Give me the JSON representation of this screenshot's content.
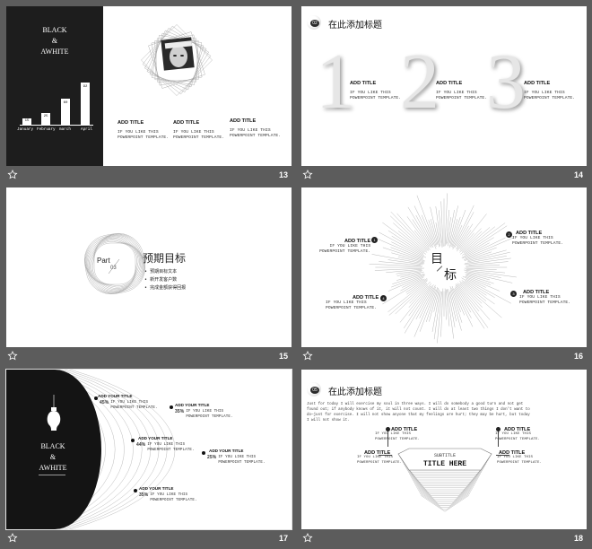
{
  "slides": [
    {
      "number": "13",
      "title": "BLACK",
      "amp": "&",
      "title2": "AWHITE",
      "bars": [
        {
          "label": "January",
          "value": "15",
          "h": 15
        },
        {
          "label": "February",
          "value": "25",
          "h": 25
        },
        {
          "label": "march",
          "value": "60",
          "h": 60
        },
        {
          "label": "April",
          "value": "92",
          "h": 92
        }
      ],
      "cols": [
        {
          "title": "ADD TITLE",
          "l1": "IF YOU LIKE THIS",
          "l2": "POWERPOINT TEMPLATE."
        },
        {
          "title": "ADD TITLE",
          "l1": "IF YOU LIKE THIS",
          "l2": "POWERPOINT TEMPLATE."
        },
        {
          "title": "ADD TITLE",
          "l1": "IF YOU LIKE THIS",
          "l2": "POWERPOINT TEMPLATE."
        }
      ]
    },
    {
      "number": "14",
      "badge": "02",
      "heading": "在此添加标题",
      "digits": [
        "1",
        "2",
        "3"
      ],
      "cols": [
        {
          "title": "ADD TITLE",
          "l1": "IF YOU LIKE THIS",
          "l2": "POWERPOINT TEMPLATE."
        },
        {
          "title": "ADD TITLE",
          "l1": "IF YOU LIKE THIS",
          "l2": "POWERPOINT TEMPLATE."
        },
        {
          "title": "ADD TITLE",
          "l1": "IF YOU LIKE THIS",
          "l2": "POWERPOINT TEMPLATE."
        }
      ]
    },
    {
      "number": "15",
      "part": "Part",
      "partnum": "03",
      "heading": "预期目标",
      "bullets": [
        "预期目标文本",
        "新开发客户数",
        "完成金额获得回报"
      ]
    },
    {
      "number": "16",
      "center1": "目",
      "center2": "标",
      "items": [
        {
          "title": "ADD TITLE",
          "l1": "IF YOU LIKE THIS",
          "l2": "POWERPOINT TEMPLATE."
        },
        {
          "title": "ADD TITLE",
          "l1": "IF YOU LIKE THIS",
          "l2": "POWERPOINT TEMPLATE."
        },
        {
          "title": "ADD TITLE",
          "l1": "IF YOU LIKE THIS",
          "l2": "POWERPOINT TEMPLATE."
        },
        {
          "title": "ADD TITLE",
          "l1": "IF YOU LIKE THIS",
          "l2": "POWERPOINT TEMPLATE."
        }
      ]
    },
    {
      "number": "17",
      "title": "BLACK",
      "amp": "&",
      "title2": "AWHITE",
      "items": [
        {
          "title": "ADD YOUR TITLE",
          "pct": "45%",
          "l1": "IF YOU LIKE THIS",
          "l2": "POWERPOINT TEMPLATE."
        },
        {
          "title": "ADD YOUR TITLE",
          "pct": "35%",
          "l1": "IF YOU LIKE THIS",
          "l2": "POWERPOINT TEMPLATE."
        },
        {
          "title": "ADD YOUR TITLE",
          "pct": "44%",
          "l1": "IF YOU LIKE THIS",
          "l2": "POWERPOINT TEMPLATE."
        },
        {
          "title": "ADD YOUR TITLE",
          "pct": "25%",
          "l1": "IF YOU LIKE THIS",
          "l2": "POWERPOINT TEMPLATE."
        },
        {
          "title": "ADD YOUR TITLE",
          "pct": "35%",
          "l1": "IF YOU LIKE THIS",
          "l2": "POWERPOINT TEMPLATE."
        }
      ]
    },
    {
      "number": "18",
      "badge": "05",
      "heading": "在此添加标题",
      "para": [
        "Just for today I will exercise my soul in three ways. I will do somebody a good turn and not get",
        "found out; if anybody knows of it, it will not count. I will do at least two things I don't want to",
        "do—just for exercise. I will not show anyone that my feelings are hurt; they may be hurt, but today",
        "I will not show it."
      ],
      "subtitle": "SUBTITLE",
      "mainTitle": "TITLE HERE",
      "items": [
        {
          "title": "ADD TITLE",
          "l1": "IF YOU LIKE THIS",
          "l2": "POWERPOINT TEMPLATE."
        },
        {
          "title": "ADD TITLE",
          "l1": "IF YOU LIKE THIS",
          "l2": "POWERPOINT TEMPLATE."
        },
        {
          "title": "ADD TITLE",
          "l1": "IF YOU LIKE THIS",
          "l2": "POWERPOINT TEMPLATE."
        },
        {
          "title": "ADD TITLE",
          "l1": "IF YOU LIKE THIS",
          "l2": "POWERPOINT TEMPLATE."
        }
      ]
    }
  ]
}
